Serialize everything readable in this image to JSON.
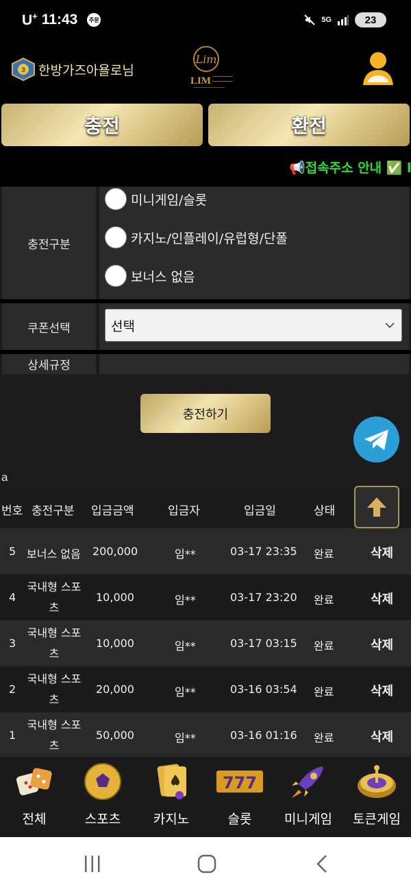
{
  "status_bar": {
    "carrier": "U",
    "carrier_sup": "+",
    "time": "11:43",
    "notif_badge": "주문",
    "network": "5G",
    "battery": "23"
  },
  "header": {
    "username": "한방가즈아욜로님",
    "logo_text": "LIM"
  },
  "actions": {
    "charge_label": "충전",
    "exchange_label": "환전"
  },
  "ticker": {
    "text": "📢접속주소 안내 ✅ l"
  },
  "form": {
    "charge_type_label": "충전구분",
    "charge_type_options": [
      "미니게임/슬롯",
      "카지노/인플레이/유럽형/단폴",
      "보너스 없음"
    ],
    "coupon_label": "쿠폰선택",
    "coupon_selected": "선택",
    "detail_label": "상세규정",
    "submit_label": "충전하기"
  },
  "history": {
    "caption": "a",
    "columns": [
      "번호",
      "충전구분",
      "입금금액",
      "입금자",
      "입금일",
      "상태"
    ],
    "rows": [
      {
        "no": "5",
        "type": "보너스 없음",
        "amount": "200,000",
        "depositor": "임**",
        "date": "03-17 23:35",
        "status": "완료",
        "action": "삭제"
      },
      {
        "no": "4",
        "type": "국내형 스포츠",
        "amount": "10,000",
        "depositor": "임**",
        "date": "03-17 23:20",
        "status": "완료",
        "action": "삭제"
      },
      {
        "no": "3",
        "type": "국내형 스포츠",
        "amount": "10,000",
        "depositor": "임**",
        "date": "03-17 03:15",
        "status": "완료",
        "action": "삭제"
      },
      {
        "no": "2",
        "type": "국내형 스포츠",
        "amount": "20,000",
        "depositor": "임**",
        "date": "03-16 03:54",
        "status": "완료",
        "action": "삭제"
      },
      {
        "no": "1",
        "type": "국내형 스포츠",
        "amount": "50,000",
        "depositor": "임**",
        "date": "03-16 01:16",
        "status": "완료",
        "action": "삭제"
      }
    ]
  },
  "nav": {
    "items": [
      {
        "label": "전체",
        "icon": "dice-icon"
      },
      {
        "label": "스포츠",
        "icon": "soccer-ball-icon"
      },
      {
        "label": "카지노",
        "icon": "cards-icon"
      },
      {
        "label": "슬롯",
        "icon": "slot-777-icon"
      },
      {
        "label": "미니게임",
        "icon": "rocket-icon"
      },
      {
        "label": "토큰게임",
        "icon": "roulette-icon"
      }
    ]
  },
  "colors": {
    "gold": "#e8d79a",
    "ticker_green": "#22e03a",
    "telegram_blue": "#2a9fd8"
  }
}
